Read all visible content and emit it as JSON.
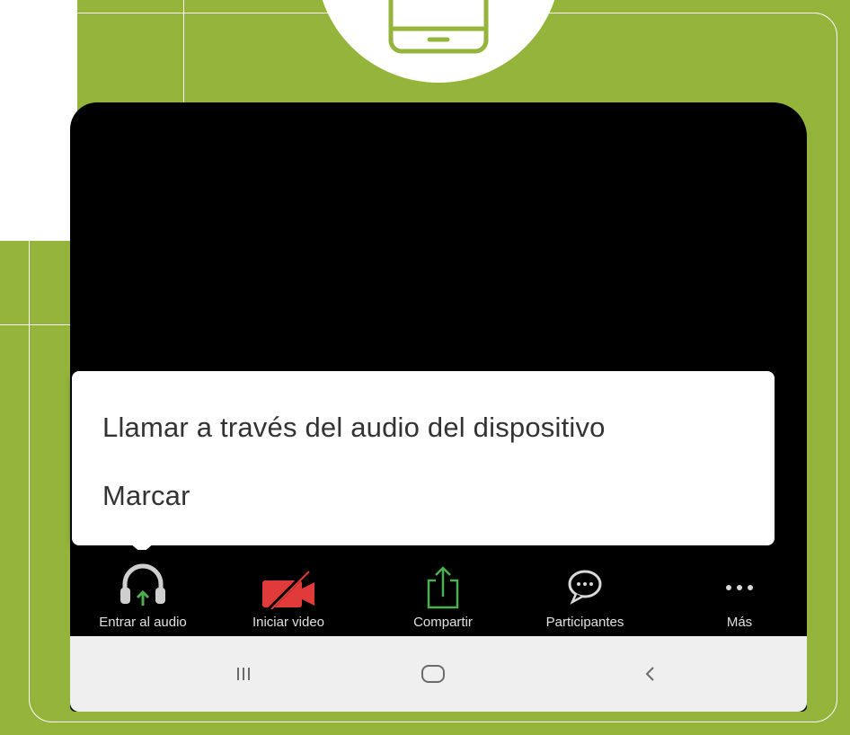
{
  "popup": {
    "items": [
      "Llamar a través del audio del dispositivo",
      "Marcar"
    ]
  },
  "toolbar": {
    "items": [
      {
        "label": "Entrar al audio",
        "icon": "headphones-icon"
      },
      {
        "label": "Iniciar video",
        "icon": "video-off-icon"
      },
      {
        "label": "Compartir",
        "icon": "share-icon"
      },
      {
        "label": "Participantes",
        "icon": "chat-bubble-icon"
      },
      {
        "label": "Más",
        "icon": "more-icon"
      }
    ]
  },
  "navbar": {
    "items": [
      "recent-apps-icon",
      "home-icon",
      "back-icon"
    ]
  },
  "colors": {
    "background": "#94b43c",
    "video_off": "#e03a3a",
    "share": "#4caf50",
    "audio_arrow": "#4caf50"
  }
}
